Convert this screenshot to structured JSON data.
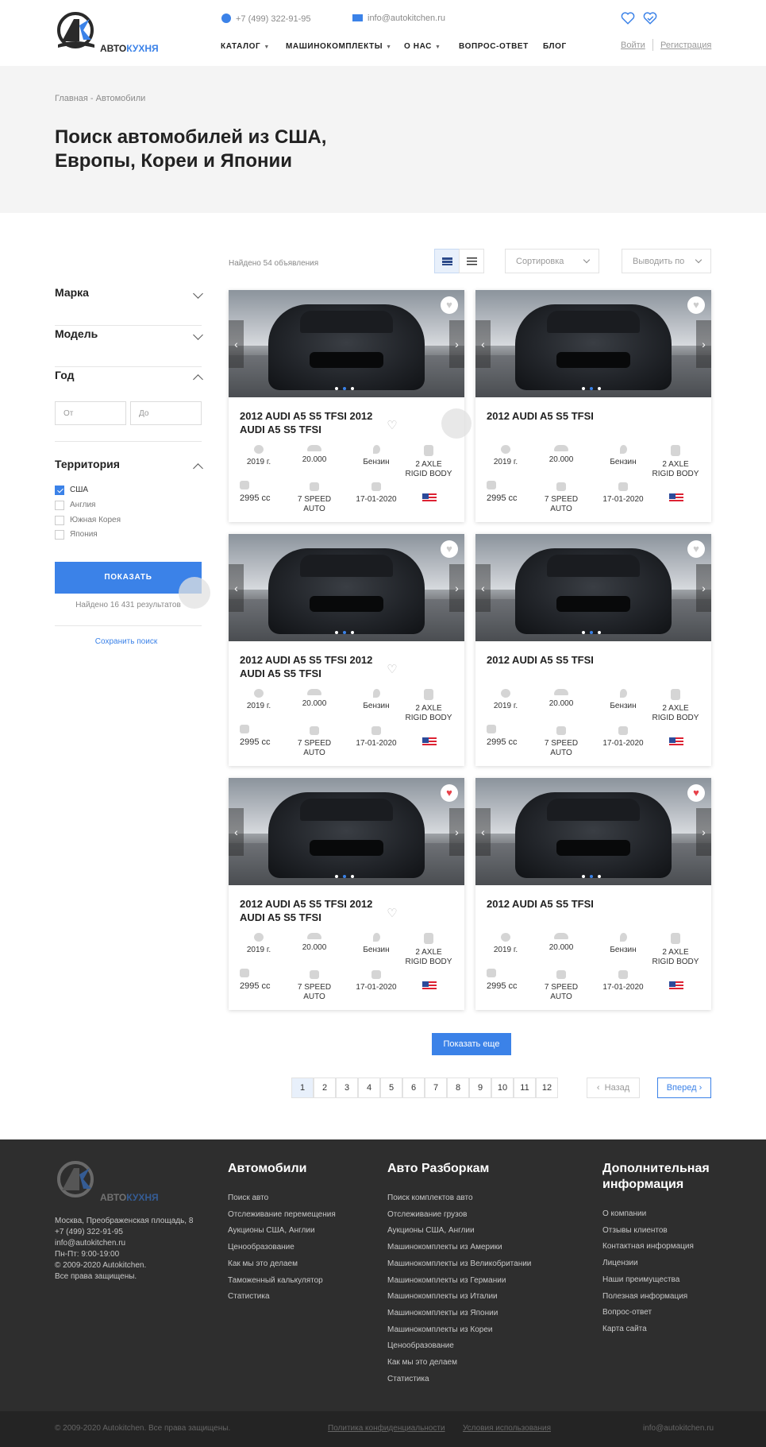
{
  "header": {
    "logo_text_left": "АВТО",
    "logo_text_right": "КУХНЯ",
    "phone": "+7 (499) 322-91-95",
    "email": "info@autokitchen.ru",
    "nav": [
      "КАТАЛОГ",
      "МАШИНОКОМПЛЕКТЫ",
      "О НАС",
      "ВОПРОС-ОТВЕТ",
      "БЛОГ"
    ],
    "login": "Войти",
    "register": "Регистрация"
  },
  "hero": {
    "breadcrumb": "Главная - Автомобили",
    "title": "Поиск автомобилей из США, Европы, Кореи и Японии"
  },
  "filters": {
    "brand": "Марка",
    "model": "Модель",
    "year": "Год",
    "year_from": "От",
    "year_to": "До",
    "territory": "Территория",
    "countries": [
      {
        "label": "США",
        "checked": true
      },
      {
        "label": "Англия",
        "checked": false
      },
      {
        "label": "Южная Корея",
        "checked": false
      },
      {
        "label": "Япония",
        "checked": false
      }
    ],
    "show_button": "ПОКАЗАТЬ",
    "found_results": "Найдено 16 431 результатов",
    "save_search": "Сохранить поиск"
  },
  "results": {
    "found": "Найдено 54 объявления",
    "sort": "Сортировка",
    "per_page": "Выводить по",
    "cards": [
      {
        "title": "2012 AUDI A5 S5 TFSI 2012 AUDI A5 S5 TFSI",
        "year": "2019 г.",
        "mileage": "20.000",
        "fuel": "Бензин",
        "body": "2 AXLE RIGID BODY",
        "engine": "2995 cc",
        "gearbox": "7 SPEED AUTO",
        "date": "17-01-2020",
        "favorite": false
      },
      {
        "title": "2012 AUDI A5 S5 TFSI",
        "year": "2019 г.",
        "mileage": "20.000",
        "fuel": "Бензин",
        "body": "2 AXLE RIGID BODY",
        "engine": "2995 cc",
        "gearbox": "7 SPEED AUTO",
        "date": "17-01-2020",
        "favorite": false
      },
      {
        "title": "2012 AUDI A5 S5 TFSI 2012 AUDI A5 S5 TFSI",
        "year": "2019 г.",
        "mileage": "20.000",
        "fuel": "Бензин",
        "body": "2 AXLE RIGID BODY",
        "engine": "2995 cc",
        "gearbox": "7 SPEED AUTO",
        "date": "17-01-2020",
        "favorite": false
      },
      {
        "title": "2012 AUDI A5 S5 TFSI",
        "year": "2019 г.",
        "mileage": "20.000",
        "fuel": "Бензин",
        "body": "2 AXLE RIGID BODY",
        "engine": "2995 cc",
        "gearbox": "7 SPEED AUTO",
        "date": "17-01-2020",
        "favorite": false
      },
      {
        "title": "2012 AUDI A5 S5 TFSI 2012 AUDI A5 S5 TFSI",
        "year": "2019 г.",
        "mileage": "20.000",
        "fuel": "Бензин",
        "body": "2 AXLE RIGID BODY",
        "engine": "2995 cc",
        "gearbox": "7 SPEED AUTO",
        "date": "17-01-2020",
        "favorite": true
      },
      {
        "title": "2012 AUDI A5 S5 TFSI",
        "year": "2019 г.",
        "mileage": "20.000",
        "fuel": "Бензин",
        "body": "2 AXLE RIGID BODY",
        "engine": "2995 cc",
        "gearbox": "7 SPEED AUTO",
        "date": "17-01-2020",
        "favorite": true
      }
    ],
    "show_more": "Показать еще",
    "pages": [
      "1",
      "2",
      "3",
      "4",
      "5",
      "6",
      "7",
      "8",
      "9",
      "10",
      "11",
      "12"
    ],
    "current_page": "1",
    "prev": "Назад",
    "next": "Вперед"
  },
  "footer": {
    "address": [
      "Москва, Преображенская площадь, 8",
      "+7 (499) 322-91-95",
      "info@autokitchen.ru",
      "Пн-Пт: 9:00-19:00",
      "© 2009-2020 Autokitchen.",
      "Все права защищены."
    ],
    "col1_title": "Автомобили",
    "col1": [
      "Поиск авто",
      "Отслеживание перемещения",
      "Аукционы США, Англии",
      "Ценообразование",
      "Как мы это делаем",
      "Таможенный калькулятор",
      "Статистика"
    ],
    "col2_title": "Авто Разборкам",
    "col2": [
      "Поиск комплектов авто",
      "Отслеживание грузов",
      "Аукционы США, Англии",
      "Машинокомплекты из Америки",
      "Машинокомплекты из Великобритании",
      "Машинокомплекты из Германии",
      "Машинокомплекты из Италии",
      "Машинокомплекты из Японии",
      "Машинокомплекты из Кореи",
      "Ценообразование",
      "Как мы это делаем",
      "Статистика"
    ],
    "col3_title": "Дополнительная информация",
    "col3": [
      "О компании",
      "Отзывы клиентов",
      "Контактная информация",
      "Лицензии",
      "Наши преимущества",
      "Полезная информация",
      "Вопрос-ответ",
      "Карта сайта"
    ],
    "copyright": "© 2009-2020 Autokitchen. Все права защищены.",
    "privacy": "Политика конфиденциальности",
    "terms": "Условия использования",
    "email": "info@autokitchen.ru"
  },
  "colors": {
    "accent": "#3b82e8",
    "footer_bg": "#2e2e2e",
    "hero_bg": "#f4f4f4",
    "favorite_on": "#e8414a"
  }
}
